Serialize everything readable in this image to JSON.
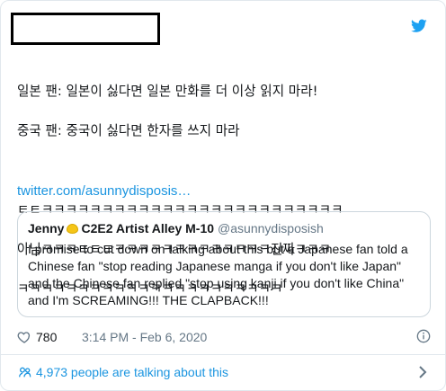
{
  "tweet": {
    "lines": [
      "일본 팬: 일본이 싫다면 일본 만화를 더 이상 읽지 마라!",
      "중국 팬: 중국이 싫다면 한자를 쓰지 마라",
      "",
      "ㅌㅌㅋㅋㅋㅋㅋㅋㅋㅋㅋㅋㅋㅋㅋㅋㅋㅋㅋㅋㅋㅋㅋㅋㅋㅋㅋ",
      "아님ㅋㅋㅋㅌㅌㅌㅋㅋㅋㅋㅋㅋㅋㅋㅋㅋㅋㅋㅋ진짜ㅋㅋㅋ",
      "ㅋㅋㅋㅋㅋㅋㅋㅋㅋㅋㅋㅋㅋㅋㅋㅋㅋㅋㅋㅋㅋㅋ"
    ],
    "link": "twitter.com/asunnydisposis…"
  },
  "quote": {
    "name": "Jenny",
    "name_suffix": "C2E2 Artist Alley M-10",
    "handle": "@asunnydisposish",
    "body_lines": [
      "I promise to cut down on talking about this but a Japanese fan told a",
      "Chinese fan \"stop reading Japanese manga if you don't like Japan\"",
      "and the Chinese fan replied \"stop using kanji if you don't like China\"",
      "and I'm SCREAMING!!! THE CLAPBACK!!!"
    ]
  },
  "meta": {
    "likes": "780",
    "timestamp": "3:14 PM - Feb 6, 2020"
  },
  "footer": {
    "talking": "4,973 people are talking about this"
  },
  "icons": {
    "brand": "twitter-bird-icon",
    "like": "heart-icon",
    "info": "info-icon",
    "people": "people-icon",
    "chevron": "chevron-right-icon",
    "emoji": "lemon-icon"
  },
  "colors": {
    "twitter_blue": "#1da1f2",
    "link": "#1b95e0",
    "muted": "#657786",
    "border": "#e1e8ed"
  }
}
